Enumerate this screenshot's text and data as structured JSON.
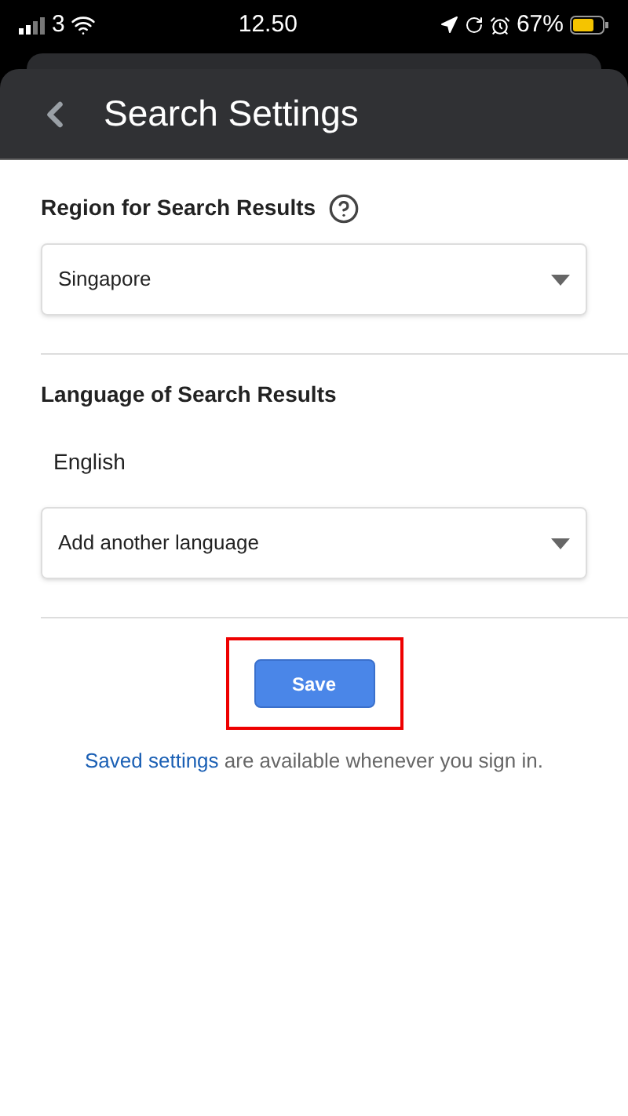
{
  "status_bar": {
    "carrier": "3",
    "time": "12.50",
    "battery": "67%"
  },
  "header": {
    "title": "Search Settings"
  },
  "region": {
    "heading": "Region for Search Results",
    "value": "Singapore"
  },
  "language": {
    "heading": "Language of Search Results",
    "current": "English",
    "add_placeholder": "Add another language"
  },
  "save": {
    "label": "Save",
    "highlighted": true
  },
  "note": {
    "link": "Saved settings",
    "text": " are available whenever you sign in."
  }
}
